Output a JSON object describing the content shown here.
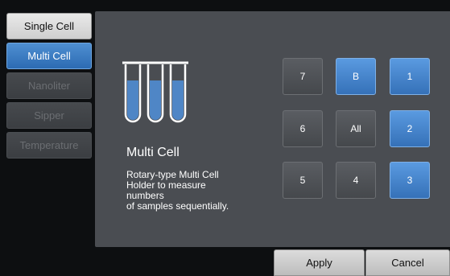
{
  "sidebar": {
    "items": [
      {
        "label": "Single Cell",
        "state": "enabled"
      },
      {
        "label": "Multi Cell",
        "state": "active"
      },
      {
        "label": "Nanoliter",
        "state": "disabled"
      },
      {
        "label": "Sipper",
        "state": "disabled"
      },
      {
        "label": "Temperature",
        "state": "disabled"
      }
    ]
  },
  "main": {
    "icon": "test-tubes-icon",
    "title": "Multi Cell",
    "description": "Rotary-type Multi Cell\nHolder to measure\nnumbers\nof samples sequentially."
  },
  "positions": [
    {
      "label": "7",
      "selected": false
    },
    {
      "label": "B",
      "selected": true
    },
    {
      "label": "1",
      "selected": true
    },
    {
      "label": "6",
      "selected": false
    },
    {
      "label": "All",
      "selected": false
    },
    {
      "label": "2",
      "selected": true
    },
    {
      "label": "5",
      "selected": false
    },
    {
      "label": "4",
      "selected": false
    },
    {
      "label": "3",
      "selected": true
    }
  ],
  "footer": {
    "apply_label": "Apply",
    "cancel_label": "Cancel"
  },
  "colors": {
    "accent": "#3d7cc4",
    "panel": "#4a4d52",
    "background": "#0d0f11"
  }
}
